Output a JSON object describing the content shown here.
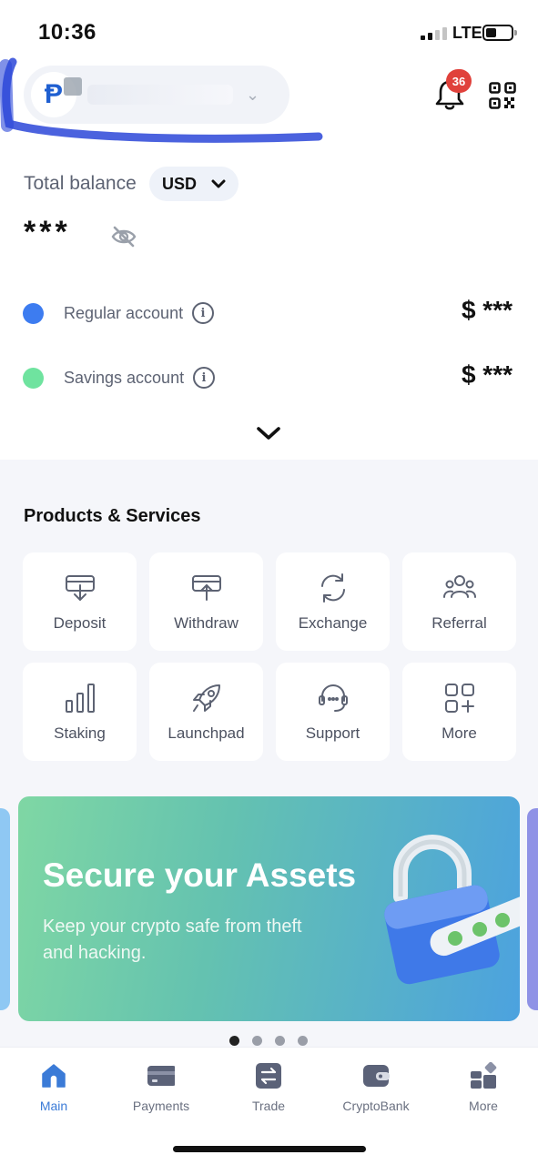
{
  "status_bar": {
    "time": "10:36",
    "network": "LTE"
  },
  "header": {
    "logo_letter": "Ᵽ",
    "notification_count": "36"
  },
  "balance": {
    "label": "Total balance",
    "currency": "USD",
    "hidden_value": "***"
  },
  "accounts": [
    {
      "label": "Regular account",
      "amount": "$ ***",
      "color": "#3d7cf0"
    },
    {
      "label": "Savings account",
      "amount": "$ ***",
      "color": "#6fe39f"
    }
  ],
  "services": {
    "title": "Products & Services",
    "items": [
      {
        "label": "Deposit",
        "icon": "deposit-icon"
      },
      {
        "label": "Withdraw",
        "icon": "withdraw-icon"
      },
      {
        "label": "Exchange",
        "icon": "exchange-icon"
      },
      {
        "label": "Referral",
        "icon": "referral-icon"
      },
      {
        "label": "Staking",
        "icon": "staking-icon"
      },
      {
        "label": "Launchpad",
        "icon": "launchpad-icon"
      },
      {
        "label": "Support",
        "icon": "support-icon"
      },
      {
        "label": "More",
        "icon": "more-grid-icon"
      }
    ]
  },
  "banner": {
    "title": "Secure your Assets",
    "subtitle": "Keep your crypto safe from theft and hacking.",
    "page_count": 4,
    "active_page": 1
  },
  "tabs": [
    {
      "label": "Main",
      "icon": "home-icon",
      "active": true
    },
    {
      "label": "Payments",
      "icon": "card-icon",
      "active": false
    },
    {
      "label": "Trade",
      "icon": "trade-icon",
      "active": false
    },
    {
      "label": "CryptoBank",
      "icon": "wallet-icon",
      "active": false
    },
    {
      "label": "More",
      "icon": "more-icon",
      "active": false
    }
  ],
  "colors": {
    "accent": "#3b7bd7",
    "badge": "#e0413b",
    "icon_gray": "#6a7080"
  }
}
